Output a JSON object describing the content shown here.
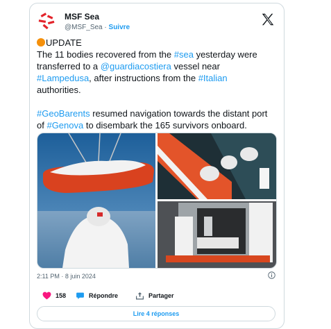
{
  "tweet": {
    "author_name": "MSF Sea",
    "author_handle": "@MSF_Sea",
    "separator": "·",
    "follow_label": "Suivre",
    "update_label": "UPDATE",
    "p1_l1a": "The 11 bodies recovered from the ",
    "p1_l1_link": "#sea",
    "p1_l1b": " yesterday were",
    "p1_l2a": "transferred to a ",
    "p1_l2_link": "@guardiacostiera",
    "p1_l2b": " vessel near",
    "p1_l3_link1": "#Lampedusa",
    "p1_l3a": ", after instructions from the ",
    "p1_l3_link2": "#Italian",
    "p1_l4": "authorities.",
    "p2_l1_link": "#GeoBarents",
    "p2_l1a": " resumed navigation towards the distant port",
    "p2_l2a": "of ",
    "p2_l2_link": "#Genova",
    "p2_l2b": " to disembark the 165 survivors onboard.",
    "timestamp": "2:11 PM · 8 juin 2024"
  },
  "actions": {
    "likes": "158",
    "reply_label": "Répondre",
    "share_label": "Partager"
  },
  "read_replies_label": "Lire 4 réponses",
  "colors": {
    "link": "#1d9bf0",
    "like": "#f91880",
    "update_dot": "#f5900b",
    "msf_red": "#e3242b"
  },
  "icons": [
    "msf-logo",
    "x-logo",
    "info-icon",
    "heart-icon",
    "reply-icon",
    "share-icon"
  ]
}
